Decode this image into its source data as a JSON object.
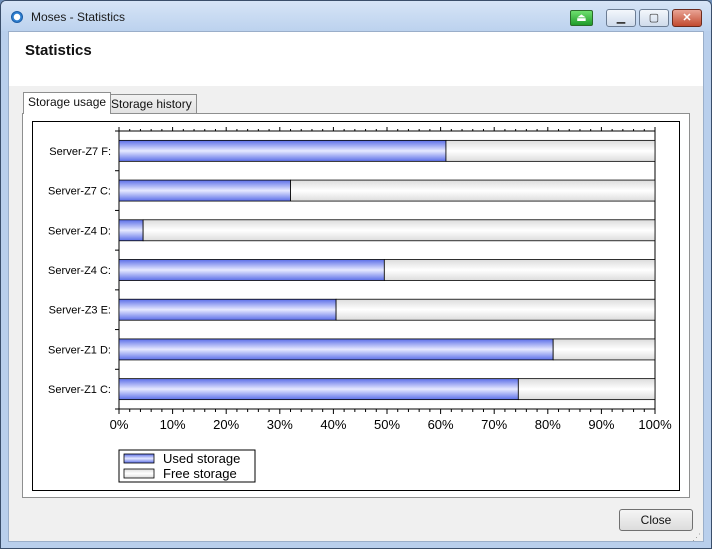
{
  "window": {
    "title": "Moses - Statistics"
  },
  "page": {
    "title": "Statistics"
  },
  "tabs": [
    {
      "label": "Storage usage",
      "active": true
    },
    {
      "label": "Storage history",
      "active": false
    }
  ],
  "buttons": {
    "close_label": "Close"
  },
  "colors": {
    "used": "#5b6ee8",
    "used_highlight": "#e6e9ff",
    "free": "#eeeeee",
    "accent": "#2e7fd0"
  },
  "chart_data": {
    "type": "bar",
    "orientation": "horizontal",
    "stacked": true,
    "categories": [
      "Server-Z7 F:",
      "Server-Z7 C:",
      "Server-Z4 D:",
      "Server-Z4 C:",
      "Server-Z3 E:",
      "Server-Z1 D:",
      "Server-Z1  C:"
    ],
    "series": [
      {
        "name": "Used storage",
        "values": [
          61,
          32,
          4.5,
          49.5,
          40.5,
          81,
          74.5
        ]
      },
      {
        "name": "Free storage",
        "values": [
          39,
          68,
          95.5,
          50.5,
          59.5,
          19,
          25.5
        ]
      }
    ],
    "xticks": [
      "0%",
      "10%",
      "20%",
      "30%",
      "40%",
      "50%",
      "60%",
      "70%",
      "80%",
      "90%",
      "100%"
    ],
    "xlim": [
      0,
      100
    ],
    "legend_position": "bottom-left"
  }
}
